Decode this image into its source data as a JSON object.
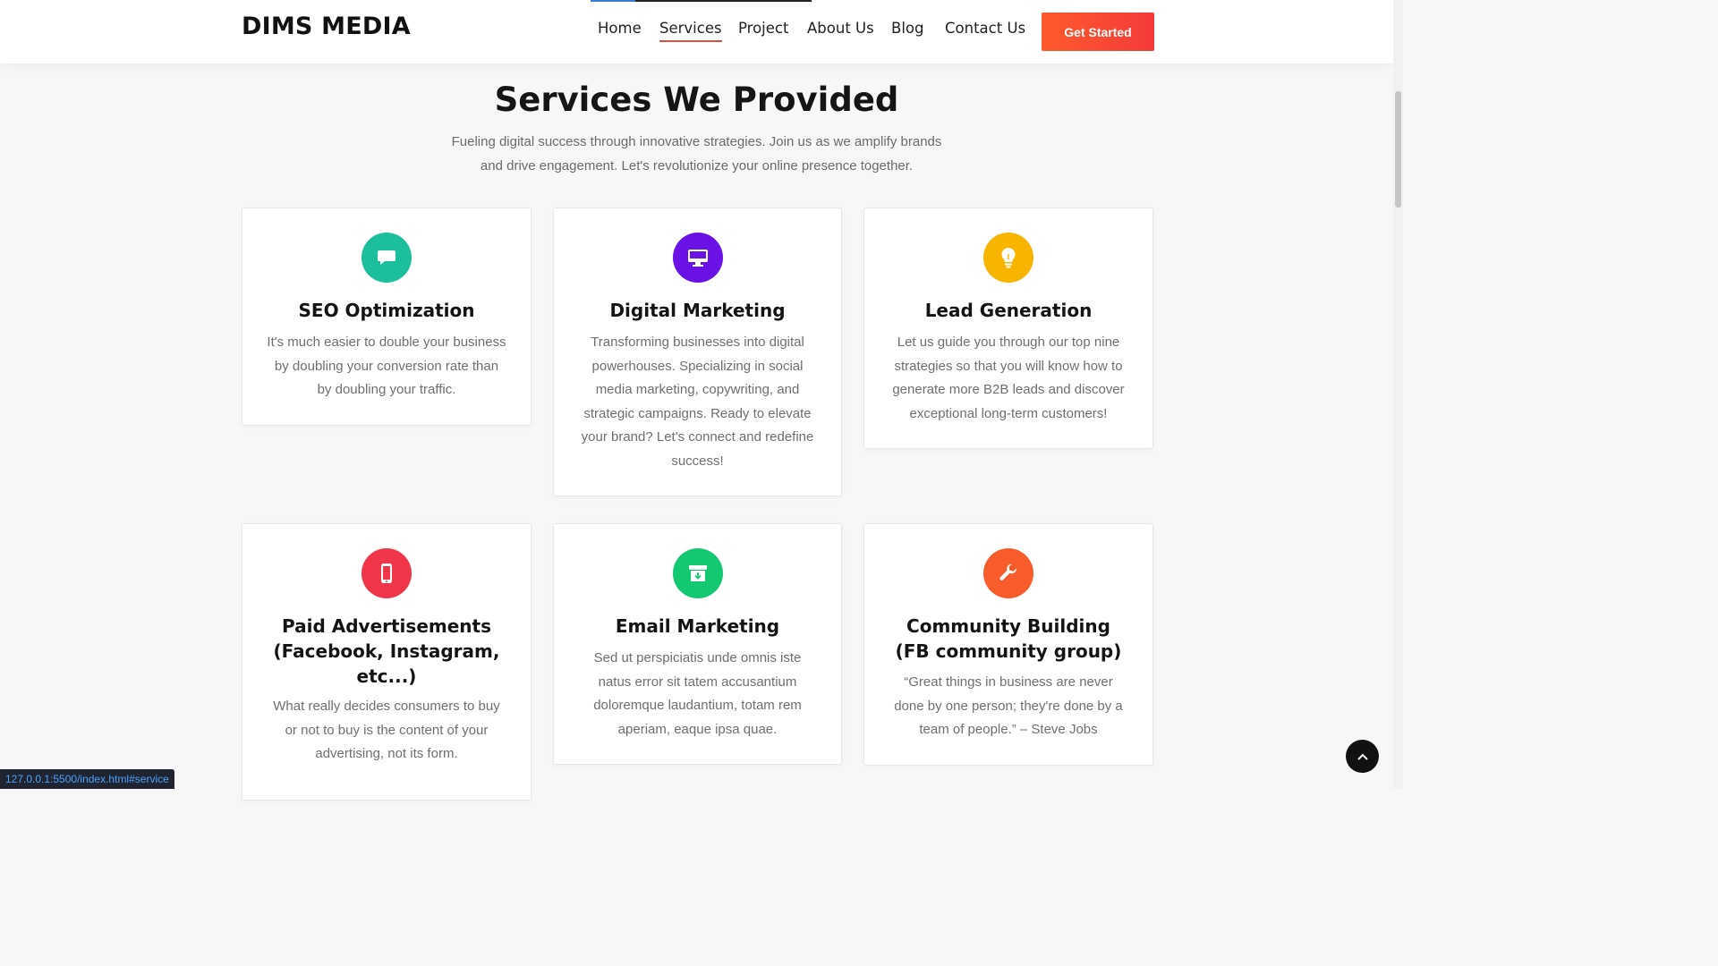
{
  "header": {
    "logo": "DIMS MEDIA",
    "nav": [
      "Home",
      "Services",
      "Project",
      "About Us",
      "Blog",
      "Contact Us"
    ],
    "active_nav": "Services",
    "cta": "Get Started"
  },
  "section": {
    "title": "Services We Provided",
    "subtitle": "Fueling digital success through innovative strategies. Join us as we amplify brands and drive engagement. Let's revolutionize your online presence together."
  },
  "services": [
    {
      "title": "SEO Optimization",
      "text": "It's much easier to double your business by doubling your conversion rate than by doubling your traffic.",
      "icon": "chat-bubble-icon",
      "color": "#1cbf9b"
    },
    {
      "title": "Digital Marketing",
      "text": "Transforming businesses into digital powerhouses. Specializing in social media marketing, copywriting, and strategic campaigns. Ready to elevate your brand? Let's connect and redefine success!",
      "icon": "monitor-icon",
      "color": "#6a11e6"
    },
    {
      "title": "Lead Generation",
      "text": "Let us guide you through our top nine strategies so that you will know how to generate more B2B leads and discover exceptional long-term customers!",
      "icon": "lightbulb-icon",
      "color": "#f7b500"
    },
    {
      "title": "Paid Advertisements (Facebook, Instagram, etc...)",
      "text": "What really decides consumers to buy or not to buy is the content of your advertising, not its form.",
      "icon": "mobile-phone-icon",
      "color": "#f2364a"
    },
    {
      "title": "Email Marketing",
      "text": "Sed ut perspiciatis unde omnis iste natus error sit tatem accusantium doloremque laudantium, totam rem aperiam, eaque ipsa quae.",
      "icon": "archive-box-icon",
      "color": "#12c972"
    },
    {
      "title": "Community Building (FB community group)",
      "text": "“Great things in business are never done by one person; they're done by a team of people.” – Steve Jobs",
      "icon": "wrench-icon",
      "color": "#f95c2b"
    }
  ],
  "status_url": "127.0.0.1:5500/index.html#service"
}
